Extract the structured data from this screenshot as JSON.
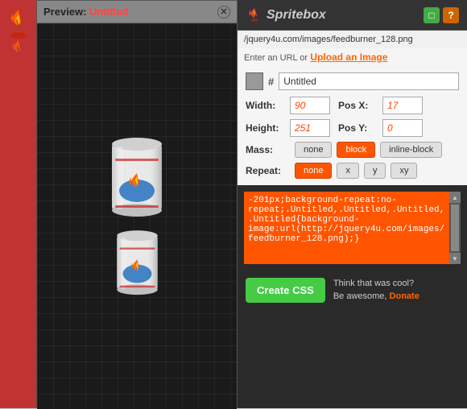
{
  "preview": {
    "title_static": "Preview: ",
    "title_dynamic": "Untitled",
    "close_symbol": "✕"
  },
  "header": {
    "logo_icon": "✦",
    "logo_prefix": "✦",
    "logo_name": "Spritebox",
    "icon1_label": "□",
    "icon2_label": "?",
    "icon_green_symbol": "□",
    "icon_question_symbol": "?"
  },
  "url_bar": {
    "value": "/jquery4u.com/images/feedburner_128.png"
  },
  "upload_section": {
    "enter_text": "Enter an URL or",
    "upload_label": "Upload an Image"
  },
  "controls": {
    "hash": "#",
    "name_value": "Untitled",
    "name_placeholder": "Untitled",
    "width_label": "Width:",
    "width_value": "90",
    "pos_x_label": "Pos X:",
    "pos_x_value": "17",
    "height_label": "Height:",
    "height_value": "251",
    "pos_y_label": "Pos Y:",
    "pos_y_value": "0",
    "mass_label": "Mass:",
    "mass_none": "none",
    "mass_block": "block",
    "mass_inline_block": "inline-block",
    "repeat_label": "Repeat:",
    "repeat_none": "none",
    "repeat_x": "x",
    "repeat_y": "y",
    "repeat_xy": "xy"
  },
  "css_output": {
    "text": "-201px;background-repeat:no-repeat;.Untitled,.Untitled,.Untitled,.Untitled{background-image:url(http://jquery4u.com/images/feedburner_128.png);}"
  },
  "footer": {
    "create_css_label": "Create CSS",
    "think_text": "Think that was cool?",
    "be_text": "Be awesome,",
    "donate_label": "Donate"
  }
}
